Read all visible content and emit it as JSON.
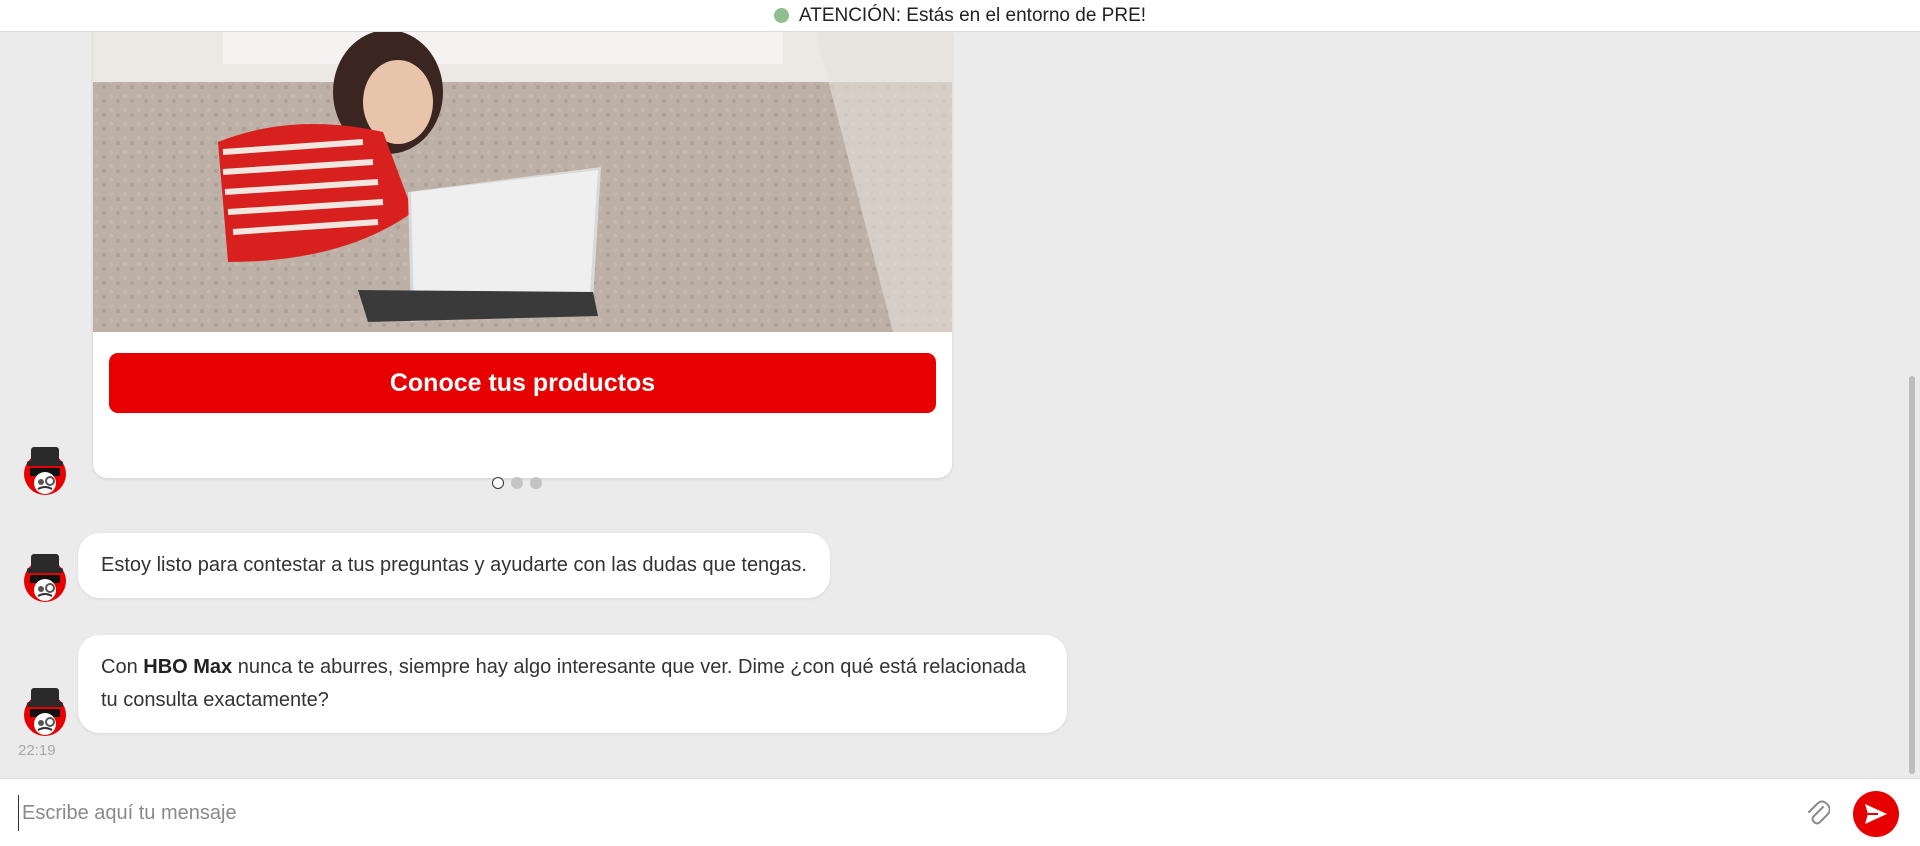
{
  "banner": {
    "text": "ATENCIÓN: Estás en el entorno de PRE!",
    "dot_color": "#8fbf8f"
  },
  "carousel": {
    "cta_label": "Conoce tus productos",
    "slide_count": 3,
    "active_index": 0
  },
  "messages": [
    {
      "parts": [
        "Estoy listo para contestar a tus preguntas y ayudarte con las dudas que tengas."
      ]
    },
    {
      "pre": "Con ",
      "bold": "HBO Max",
      "post": " nunca te aburres, siempre hay algo interesante que ver. Dime ¿con qué está relacionada tu consulta exactamente?"
    }
  ],
  "timestamp": "22:19",
  "composer": {
    "placeholder": "Escribe aquí tu mensaje",
    "value": ""
  },
  "icons": {
    "avatar": "robot-avatar-icon",
    "attach": "paperclip-icon",
    "send": "send-arrow-icon"
  },
  "colors": {
    "brand_red": "#e60000",
    "background": "#ebebeb"
  }
}
